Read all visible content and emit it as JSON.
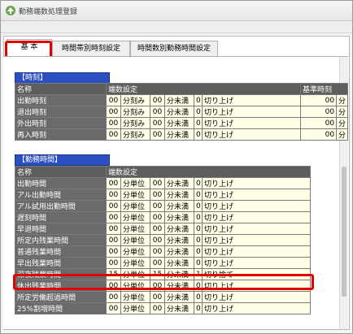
{
  "window": {
    "title": "勤務端数処理登録"
  },
  "tabs": [
    {
      "label": "基 本",
      "active": true
    },
    {
      "label": "時間帯別時刻設定",
      "active": false
    },
    {
      "label": "時間数別勤務時間設定",
      "active": false
    }
  ],
  "jikoku": {
    "title": "【時刻】",
    "headers": {
      "name": "名称",
      "setting": "端数設定",
      "standard": "基準時刻"
    },
    "rows": [
      {
        "name": "出勤時刻",
        "v1": "00",
        "u1": "分刻み",
        "v2": "00",
        "u2": "分未満",
        "v3": "0",
        "mode": "切り上げ",
        "std": "00",
        "std_unit": "分"
      },
      {
        "name": "退出時刻",
        "v1": "00",
        "u1": "分刻み",
        "v2": "00",
        "u2": "分未満",
        "v3": "0",
        "mode": "切り上げ",
        "std": "00",
        "std_unit": "分"
      },
      {
        "name": "外出時刻",
        "v1": "00",
        "u1": "分刻み",
        "v2": "00",
        "u2": "分未満",
        "v3": "0",
        "mode": "切り上げ",
        "std": "00",
        "std_unit": "分"
      },
      {
        "name": "再入時刻",
        "v1": "00",
        "u1": "分刻み",
        "v2": "00",
        "u2": "分未満",
        "v3": "0",
        "mode": "切り上げ",
        "std": "00",
        "std_unit": "分"
      }
    ]
  },
  "kinmu": {
    "title": "【勤務時間】",
    "headers": {
      "name": "名称",
      "setting": "端数設定"
    },
    "rows": [
      {
        "name": "出勤時間",
        "v1": "00",
        "u1": "分単位",
        "v2": "00",
        "u2": "分未満",
        "v3": "0",
        "mode": "切り上げ"
      },
      {
        "name": "アル出勤時間",
        "v1": "00",
        "u1": "分単位",
        "v2": "00",
        "u2": "分未満",
        "v3": "0",
        "mode": "切り上げ"
      },
      {
        "name": "アル試用出勤時間",
        "v1": "00",
        "u1": "分単位",
        "v2": "00",
        "u2": "分未満",
        "v3": "0",
        "mode": "切り上げ"
      },
      {
        "name": "遅刻時間",
        "v1": "00",
        "u1": "分単位",
        "v2": "00",
        "u2": "分未満",
        "v3": "0",
        "mode": "切り上げ"
      },
      {
        "name": "早退時間",
        "v1": "00",
        "u1": "分単位",
        "v2": "00",
        "u2": "分未満",
        "v3": "0",
        "mode": "切り上げ"
      },
      {
        "name": "所定内残業時間",
        "v1": "00",
        "u1": "分単位",
        "v2": "00",
        "u2": "分未満",
        "v3": "0",
        "mode": "切り上げ"
      },
      {
        "name": "普通残業時間",
        "v1": "00",
        "u1": "分単位",
        "v2": "00",
        "u2": "分未満",
        "v3": "0",
        "mode": "切り上げ"
      },
      {
        "name": "早出残業時間",
        "v1": "00",
        "u1": "分単位",
        "v2": "00",
        "u2": "分未満",
        "v3": "0",
        "mode": "切り上げ"
      },
      {
        "name": "深夜残業時間",
        "v1": "15",
        "u1": "分単位",
        "v2": "15",
        "u2": "分未満",
        "v3": "1",
        "mode": "切り捨て"
      },
      {
        "name": "休出残業時間",
        "v1": "00",
        "u1": "分単位",
        "v2": "00",
        "u2": "分未満",
        "v3": "0",
        "mode": "切り上げ"
      },
      {
        "name": "所定労働超過時間",
        "v1": "00",
        "u1": "分単位",
        "v2": "00",
        "u2": "分未満",
        "v3": "0",
        "mode": "切り上げ"
      },
      {
        "name": "25%割増時間",
        "v1": "00",
        "u1": "分単位",
        "v2": "00",
        "u2": "分未満",
        "v3": "0",
        "mode": "切り上げ"
      }
    ]
  },
  "icons": {
    "app": "app-logo-icon"
  },
  "colors": {
    "highlight": "#e10000",
    "section_title": "#2a4fc0",
    "header": "#5d5d5d",
    "cell": "#ffffe8"
  }
}
